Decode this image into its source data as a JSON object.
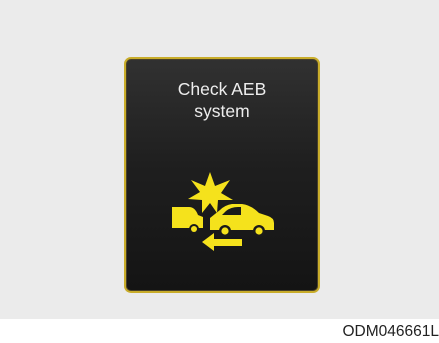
{
  "display": {
    "title_line1": "Check AEB",
    "title_line2": "system",
    "icon": "aeb-warning-icon",
    "icon_color": "#f5e21c",
    "border_color": "#c9ad2b",
    "background_color": "#1f1f1f"
  },
  "figure_code": "ODM046661L"
}
